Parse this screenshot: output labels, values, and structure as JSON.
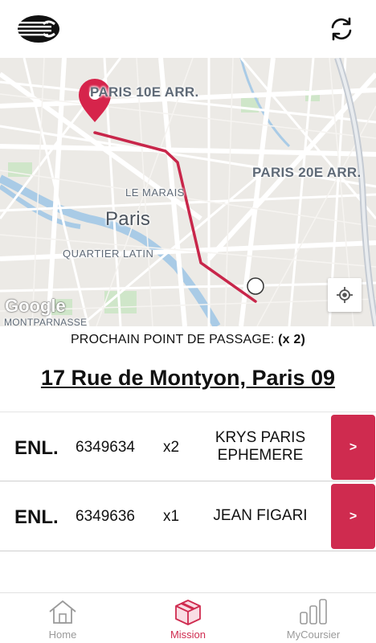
{
  "header": {
    "logo_icon": "company-logo-icon",
    "refresh_icon": "refresh-icon"
  },
  "map": {
    "labels": {
      "district_10": "PARIS 10E ARR.",
      "district_20": "PARIS 20E ARR.",
      "le_marais": "LE MARAIS",
      "paris": "Paris",
      "quartier_latin": "QUARTIER LATIN",
      "montparnasse": "MONTPARNASSE"
    },
    "attribution": "Google",
    "route_color": "#c8264a",
    "marker_color": "#d6244b"
  },
  "next_point": {
    "label": "PROCHAIN POINT DE PASSAGE:",
    "count": "(x 2)",
    "address": "17 Rue de Montyon, Paris 09"
  },
  "tasks": [
    {
      "type": "ENL.",
      "code": "6349634",
      "qty": "x2",
      "client": "KRYS PARIS EPHEMERE",
      "action": ">"
    },
    {
      "type": "ENL.",
      "code": "6349636",
      "qty": "x1",
      "client": "JEAN FIGARI",
      "action": ">"
    }
  ],
  "nav": {
    "items": [
      {
        "label": "Home",
        "icon": "home-icon",
        "active": false
      },
      {
        "label": "Mission",
        "icon": "package-icon",
        "active": true
      },
      {
        "label": "MyCoursier",
        "icon": "bar-chart-icon",
        "active": false
      }
    ],
    "accent_color": "#cf2b4f",
    "inactive_color": "#9a9a9a"
  }
}
